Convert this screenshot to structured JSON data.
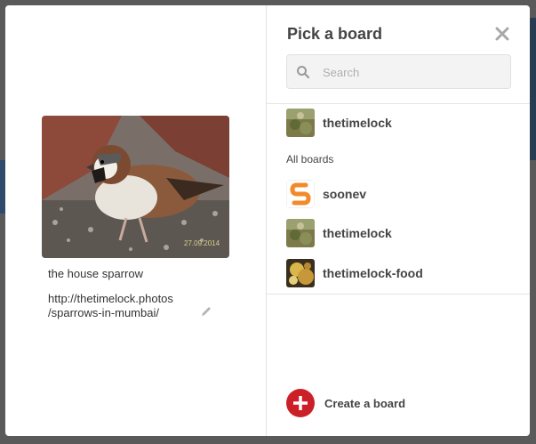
{
  "pin": {
    "description": "the house sparrow",
    "url_line1": "http://thetimelock.photos",
    "url_line2": "/sparrows-in-mumbai/",
    "image_watermark": "27.09.2014"
  },
  "picker": {
    "title": "Pick a board",
    "search_placeholder": "Search",
    "top_board": {
      "name": "thetimelock",
      "icon": "moss-thumbnail"
    },
    "section_label": "All boards",
    "boards": [
      {
        "name": "soonev",
        "icon": "soonev-logo-thumbnail"
      },
      {
        "name": "thetimelock",
        "icon": "moss-thumbnail"
      },
      {
        "name": "thetimelock-food",
        "icon": "food-thumbnail"
      }
    ],
    "create_label": "Create a board"
  },
  "colors": {
    "accent_red": "#cb2027",
    "overlay": "#5a5a5a"
  }
}
